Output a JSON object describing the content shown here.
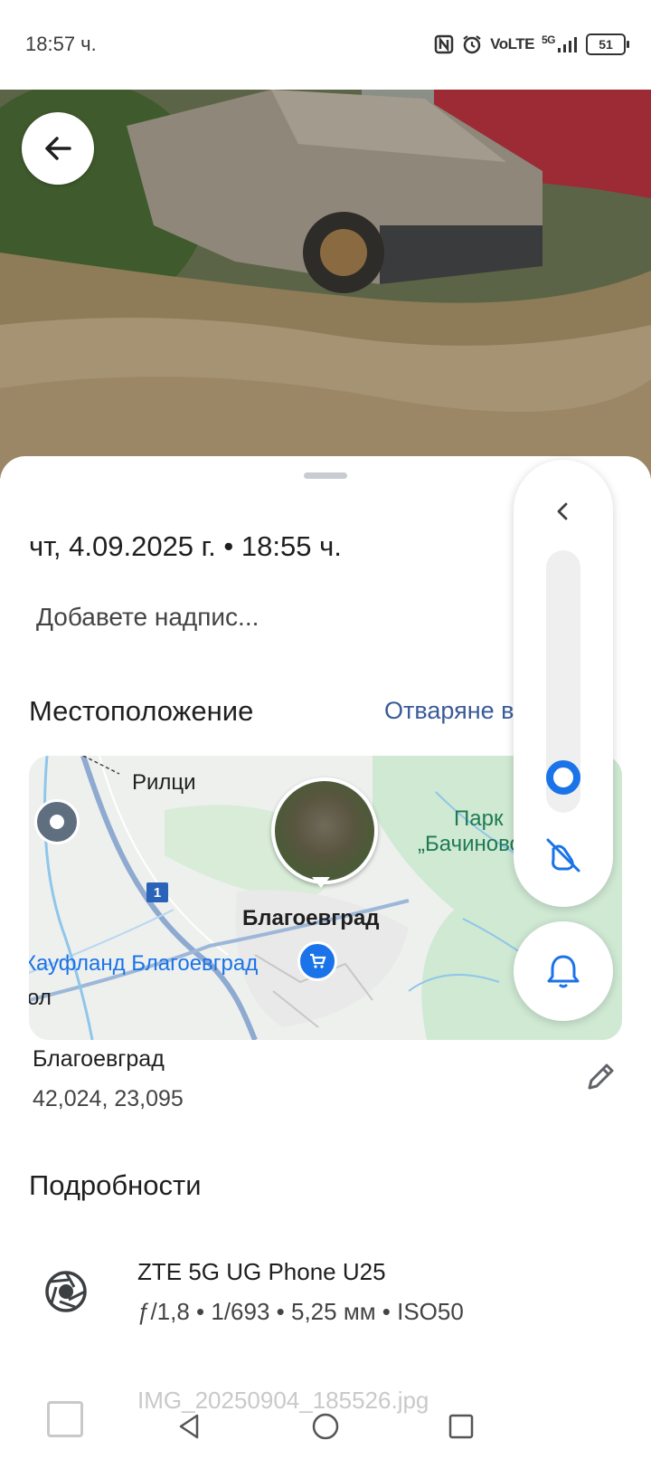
{
  "status_bar": {
    "time": "18:57 ч.",
    "network": "VoLTE",
    "network_gen": "5G",
    "battery": "51"
  },
  "photo": {
    "description_icon": "photo-scene"
  },
  "sheet": {
    "date_time": "чт, 4.09.2025 г. • 18:55 ч.",
    "caption_placeholder": "Добавете надпис...",
    "location_title": "Местоположение",
    "open_in_maps": "Отваряне в Карти",
    "map": {
      "labels": {
        "rilci": "Рилци",
        "blagoevgrad": "Благоевград",
        "kaufland": "Кауфланд Благоевград",
        "park": "Парк",
        "bachinovo": "„Бачиново\"",
        "ol": "ол",
        "road": "1"
      }
    },
    "place_name": "Благоевград",
    "place_coords": "42,024, 23,095",
    "details_title": "Подробности",
    "device_name": "ZTE 5G UG Phone U25",
    "device_specs": "ƒ/1,8  •  1/693  •  5,25 мм  •  ISO50",
    "file_name": "IMG_20250904_185526.jpg"
  },
  "volume_panel": {
    "level_fraction": 0.08
  },
  "colors": {
    "accent": "#1a73e8",
    "link": "#3a5a99",
    "map_green": "#cfe9d3"
  }
}
